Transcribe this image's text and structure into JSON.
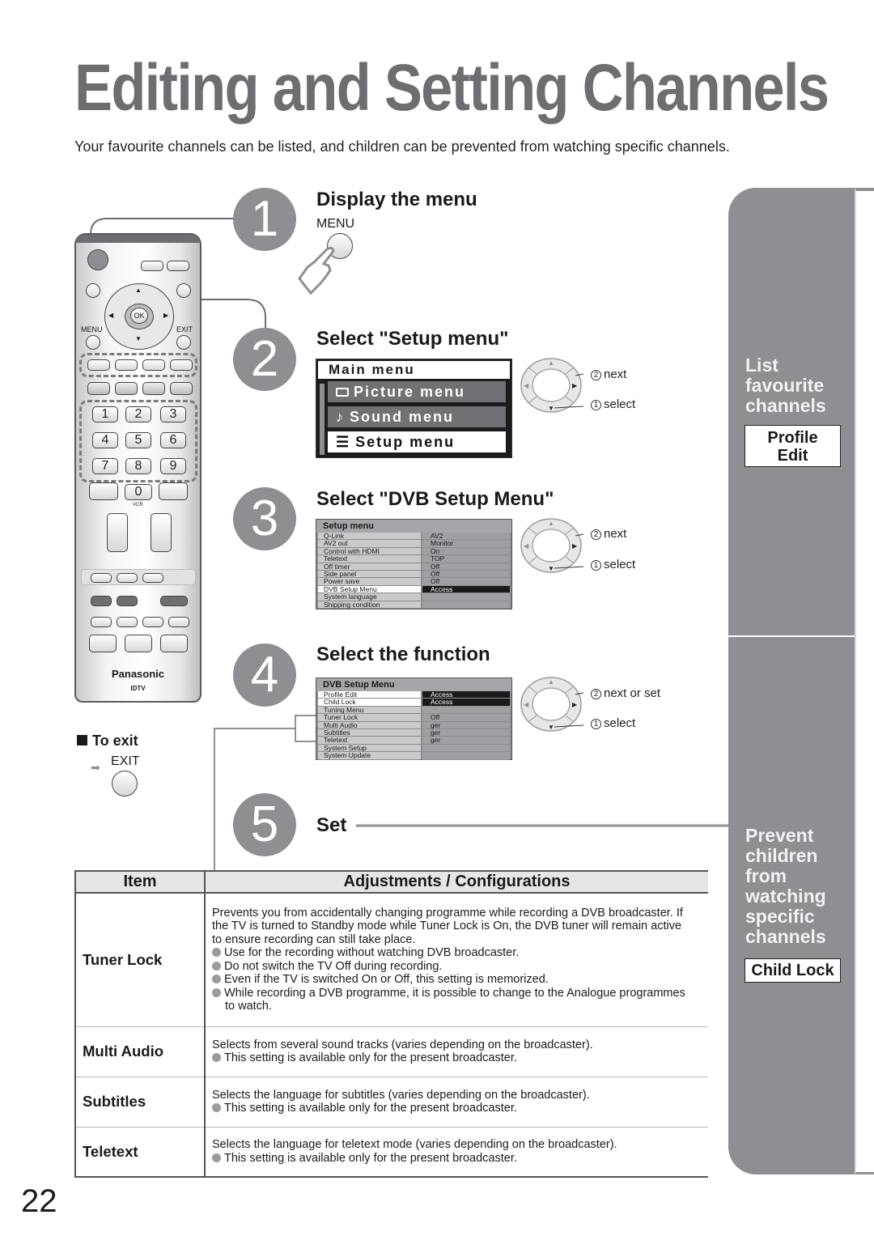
{
  "page": {
    "title": "Editing and Setting Channels",
    "subtitle": "Your favourite channels can be listed, and children can be prevented from watching specific channels.",
    "page_number": "22"
  },
  "remote": {
    "brand": "Panasonic",
    "model": "IDTV",
    "menu_label": "MENU",
    "exit_label": "EXIT",
    "ok_label": "OK",
    "vcr_label": "VCR",
    "numbers": [
      "1",
      "2",
      "3",
      "4",
      "5",
      "6",
      "7",
      "8",
      "9",
      "0"
    ]
  },
  "to_exit": {
    "heading": "To exit",
    "button_label": "EXIT"
  },
  "steps": [
    {
      "number": "1",
      "title": "Display the menu",
      "button_label": "MENU"
    },
    {
      "number": "2",
      "title": "Select \"Setup menu\""
    },
    {
      "number": "3",
      "title": "Select \"DVB Setup Menu\""
    },
    {
      "number": "4",
      "title": "Select the function"
    },
    {
      "number": "5",
      "title": "Set"
    }
  ],
  "main_menu": {
    "title": "Main menu",
    "items": [
      {
        "label": "Picture menu",
        "icon": "screen-icon",
        "selected": false
      },
      {
        "label": "Sound menu",
        "icon": "music-note-icon",
        "selected": false
      },
      {
        "label": "Setup menu",
        "icon": "list-icon",
        "selected": true
      }
    ]
  },
  "setup_menu": {
    "title": "Setup menu",
    "rows": [
      {
        "key": "Q-Link",
        "value": "AV2"
      },
      {
        "key": "AV2 out",
        "value": "Monitor"
      },
      {
        "key": "Control with HDMI",
        "value": "On"
      },
      {
        "key": "Teletext",
        "value": "TOP"
      },
      {
        "key": "Off timer",
        "value": "Off"
      },
      {
        "key": "Side panel",
        "value": "Off"
      },
      {
        "key": "Power save",
        "value": "Off"
      },
      {
        "key": "DVB Setup Menu",
        "value": "Access",
        "highlight": true
      },
      {
        "key": "System language",
        "value": ""
      },
      {
        "key": "Shipping condition",
        "value": ""
      }
    ]
  },
  "dvb_menu": {
    "title": "DVB Setup Menu",
    "rows": [
      {
        "key": "Profile Edit",
        "value": "Access",
        "highlight": true
      },
      {
        "key": "Child Lock",
        "value": "Access",
        "highlight": true
      },
      {
        "key": "Tuning Menu",
        "value": ""
      },
      {
        "key": "Tuner Lock",
        "value": "Off"
      },
      {
        "key": "Multi Audio",
        "value": "ger"
      },
      {
        "key": "Subtitles",
        "value": "ger"
      },
      {
        "key": "Teletext",
        "value": "ger"
      },
      {
        "key": "System Setup",
        "value": ""
      },
      {
        "key": "System Update",
        "value": ""
      }
    ]
  },
  "nav_hints": {
    "step2": {
      "next": "next",
      "select": "select",
      "n2": "2",
      "n1": "1"
    },
    "step3": {
      "next": "next",
      "select": "select",
      "n2": "2",
      "n1": "1"
    },
    "step4": {
      "next": "next or set",
      "select": "select",
      "n2": "2",
      "n1": "1"
    }
  },
  "side_tabs": {
    "top": {
      "heading_lines": [
        "List",
        "favourite",
        "channels"
      ],
      "box_lines": [
        "Profile",
        "Edit"
      ]
    },
    "bottom": {
      "heading_lines": [
        "Prevent",
        "children",
        "from",
        "watching",
        "specific",
        "channels"
      ],
      "box_lines": [
        "Child Lock"
      ]
    },
    "colors": {
      "tab_gray": "#8e8f93",
      "heading_text": "#f2f2f2"
    }
  },
  "table": {
    "headers": [
      "Item",
      "Adjustments / Configurations"
    ],
    "rows": [
      {
        "item": "Tuner Lock",
        "text": "Prevents you from accidentally changing programme while recording a DVB broadcaster. If the TV is turned to Standby mode while Tuner Lock is On, the DVB tuner will remain active to ensure recording can still take place.",
        "bullets": [
          "Use for the recording without watching DVB broadcaster.",
          "Do not switch the TV Off during recording.",
          "Even if the TV is switched On or Off, this setting is memorized.",
          "While recording a DVB programme, it is possible to change to the Analogue programmes to watch."
        ]
      },
      {
        "item": "Multi Audio",
        "text": "Selects from several sound tracks (varies depending on the broadcaster).",
        "bullets": [
          "This setting is available only for the present broadcaster."
        ]
      },
      {
        "item": "Subtitles",
        "text": "Selects the language for subtitles (varies depending on the broadcaster).",
        "bullets": [
          "This setting is available only for the present broadcaster."
        ]
      },
      {
        "item": "Teletext",
        "text": "Selects the language for teletext mode (varies depending on the broadcaster).",
        "bullets": [
          "This setting is available only for the present broadcaster."
        ]
      }
    ]
  }
}
